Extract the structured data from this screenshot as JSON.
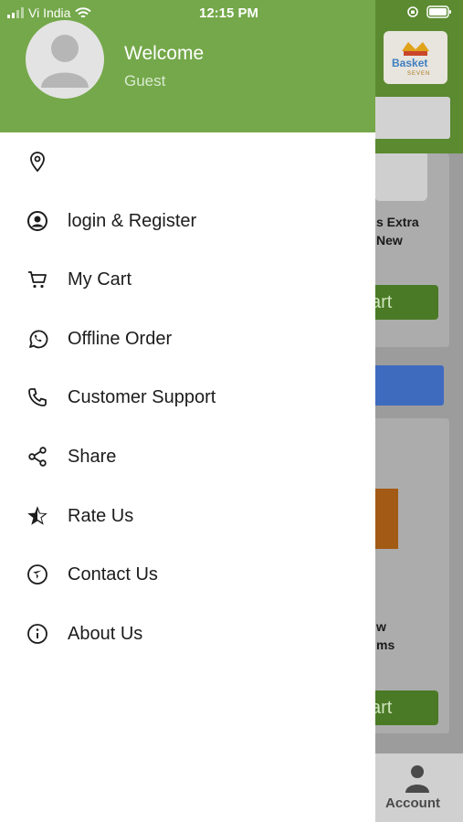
{
  "status_bar": {
    "carrier": "Vi India",
    "time": "12:15 PM"
  },
  "background": {
    "logo_text": "Basket",
    "logo_sub": "SEVEN",
    "product_1_text": [
      "s Extra",
      " New"
    ],
    "product_2_text": [
      "w",
      "ms"
    ],
    "cart_button_label": "art",
    "bottom_nav_label": "Account"
  },
  "drawer": {
    "welcome": "Welcome",
    "user": "Guest",
    "items": [
      {
        "label": "",
        "icon": "location-pin-icon"
      },
      {
        "label": "login & Register",
        "icon": "user-circle-icon"
      },
      {
        "label": "My Cart",
        "icon": "cart-icon"
      },
      {
        "label": "Offline Order",
        "icon": "whatsapp-icon"
      },
      {
        "label": "Customer Support",
        "icon": "phone-icon"
      },
      {
        "label": "Share",
        "icon": "share-icon"
      },
      {
        "label": "Rate Us",
        "icon": "star-icon"
      },
      {
        "label": "Contact Us",
        "icon": "navigation-icon"
      },
      {
        "label": "About Us",
        "icon": "info-icon"
      }
    ]
  },
  "colors": {
    "drawer_header": "#74a84a",
    "text": "#1c1c1c",
    "overlay_header": "#5b8a30"
  }
}
